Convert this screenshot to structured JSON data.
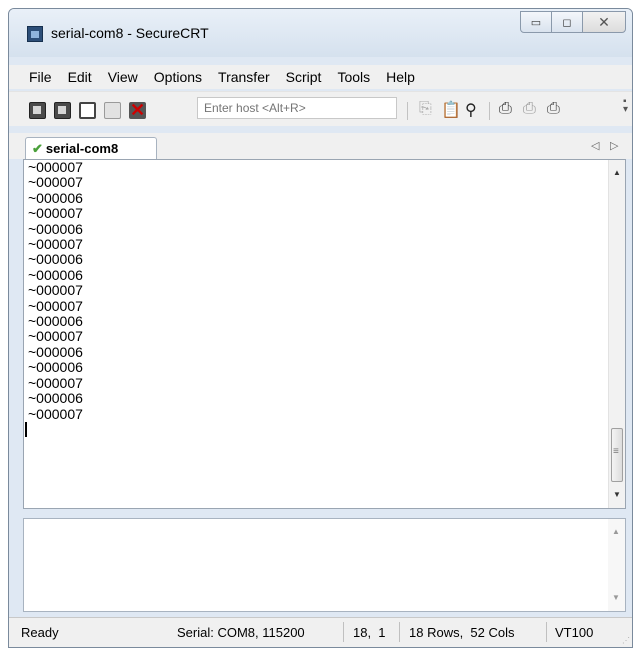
{
  "window": {
    "title": "serial-com8 - SecureCRT",
    "minimize_glyph": "▭",
    "maximize_glyph": "◻",
    "close_glyph": "✕"
  },
  "menu": [
    "File",
    "Edit",
    "View",
    "Options",
    "Transfer",
    "Script",
    "Tools",
    "Help"
  ],
  "toolbar": {
    "host_placeholder": "Enter host <Alt+R>",
    "icons": [
      "connect-icon",
      "quick-connect-icon",
      "connect-tab-icon",
      "reconnect-icon",
      "disconnect-icon",
      "copy-icon",
      "paste-icon",
      "find-icon",
      "print-screen-icon",
      "print-selection-icon",
      "print-icon"
    ]
  },
  "tab": {
    "label": "serial-com8",
    "status_icon": "connected-check-icon",
    "check_glyph": "✔",
    "prev_glyph": "◁",
    "next_glyph": "▷"
  },
  "terminal": {
    "lines": [
      "~000007",
      "~000007",
      "~000006",
      "~000007",
      "~000006",
      "~000007",
      "~000006",
      "~000006",
      "~000007",
      "~000007",
      "~000006",
      "~000007",
      "~000006",
      "~000006",
      "~000007",
      "~000006",
      "~000007"
    ]
  },
  "scroll": {
    "up_glyph": "▲",
    "down_glyph": "▼"
  },
  "status": {
    "state": "Ready",
    "connection": "Serial: COM8, 115200",
    "cursor_pos": "18,  1",
    "size": "18 Rows,  52 Cols",
    "emulation": "VT100"
  },
  "colors": {
    "chrome": "#f0f0f0",
    "titlebar": "#dfe8f3",
    "connected_check": "#4aa03a",
    "disconnect_x": "#c00000"
  }
}
